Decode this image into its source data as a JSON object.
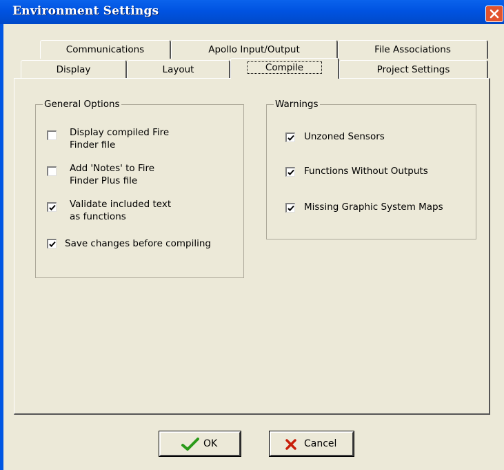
{
  "window": {
    "title": "Environment Settings"
  },
  "tabs": {
    "row1": [
      "Communications",
      "Apollo Input/Output",
      "File Associations"
    ],
    "row2": [
      "Display",
      "Layout",
      "Compile",
      "Project Settings"
    ],
    "active": "Compile"
  },
  "general_options": {
    "title": "General Options",
    "items": [
      {
        "line1": "Display compiled Fire",
        "line2": "Finder file",
        "checked": false
      },
      {
        "line1": "Add 'Notes' to Fire",
        "line2": "Finder Plus file",
        "checked": false
      },
      {
        "line1": "Validate included text",
        "line2": "as functions",
        "checked": true
      },
      {
        "line1": "Save changes before compiling",
        "line2": "",
        "checked": true
      }
    ]
  },
  "warnings": {
    "title": "Warnings",
    "items": [
      {
        "label": "Unzoned Sensors",
        "checked": true
      },
      {
        "label": "Functions Without Outputs",
        "checked": true
      },
      {
        "label": "Missing Graphic System Maps",
        "checked": true
      }
    ]
  },
  "buttons": {
    "ok": "OK",
    "cancel": "Cancel"
  },
  "icons": {
    "close": "close-icon",
    "ok": "checkmark-icon",
    "cancel": "x-icon"
  },
  "colors": {
    "titlebar": "#0053e1",
    "face": "#ece9d8",
    "close": "#e2532d",
    "ok_icon": "#2a9a1a",
    "cancel_icon": "#c81e0a"
  }
}
